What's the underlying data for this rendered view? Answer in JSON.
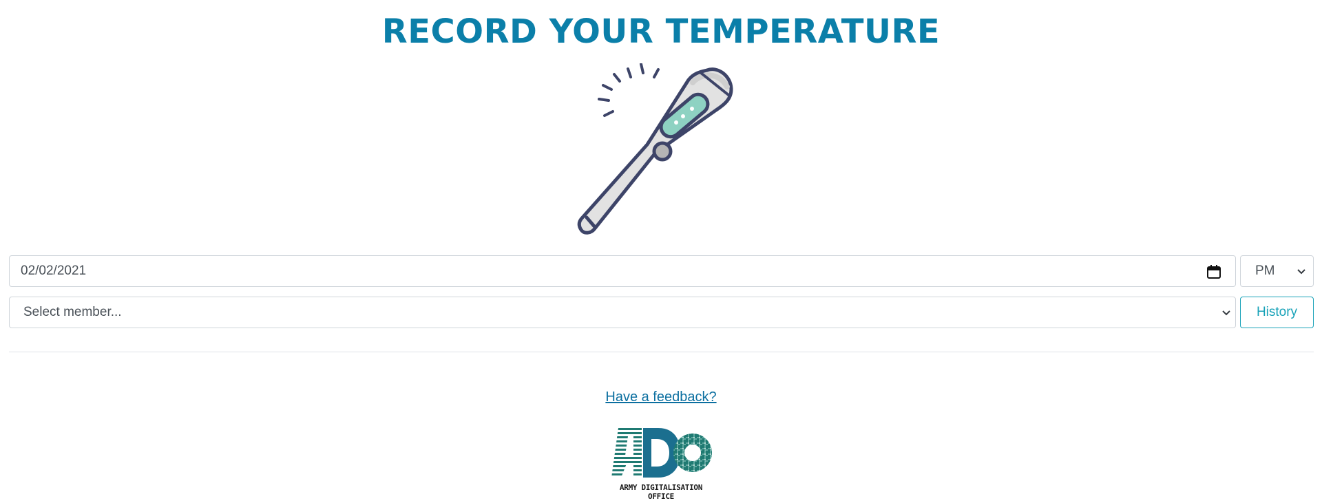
{
  "header": {
    "title": "RECORD YOUR TEMPERATURE"
  },
  "illustration": {
    "icon": "thermometer-icon",
    "colors": {
      "outline": "#3d4468",
      "body": "#e2e2e2",
      "display": "#8ed2c2"
    }
  },
  "form": {
    "date_value": "02/02/2021",
    "period_value": "PM",
    "member_placeholder": "Select member...",
    "history_label": "History"
  },
  "footer": {
    "feedback_link": "Have a feedback?",
    "logo_caption": "ARMY DIGITALISATION OFFICE"
  },
  "colors": {
    "title": "#0b7fa9",
    "accent": "#17a2b8",
    "link": "#0b6fa0",
    "logo_teal": "#1f7a72"
  }
}
